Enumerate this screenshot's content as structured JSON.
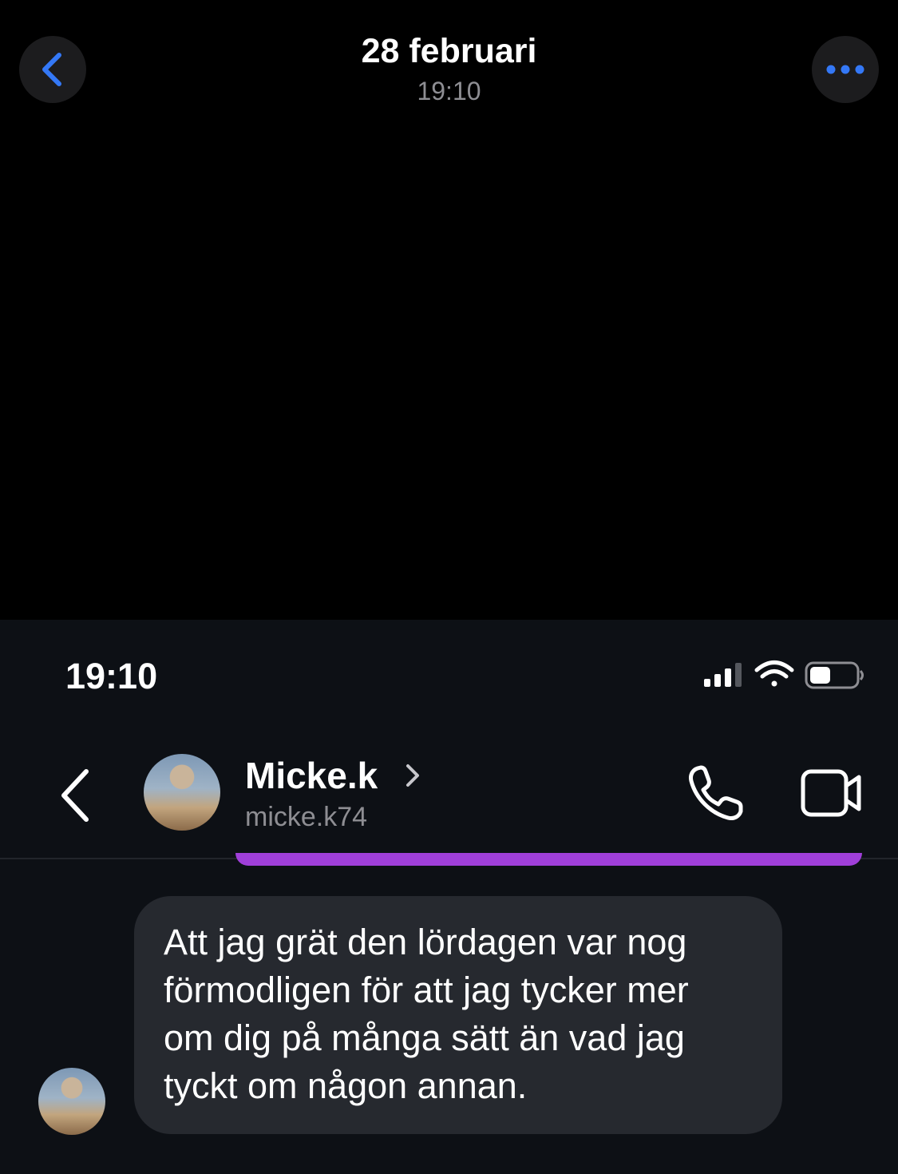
{
  "viewer": {
    "date": "28 februari",
    "time": "19:10",
    "back_icon": "chevron-left-icon",
    "more_icon": "ellipsis-icon",
    "accent_color": "#3478f6"
  },
  "status_bar": {
    "time": "19:10",
    "signal_icon": "signal-icon",
    "wifi_icon": "wifi-icon",
    "battery_icon": "battery-icon",
    "battery_level": 0.45
  },
  "chat_header": {
    "name": "Micke.k",
    "handle": "micke.k74",
    "back_icon": "chevron-left-icon",
    "name_chevron_icon": "chevron-right-icon",
    "call_icon": "phone-icon",
    "video_icon": "video-camera-icon"
  },
  "messages": [
    {
      "direction": "incoming",
      "text": "Att jag grät den lördagen var nog\nförmodligen för att jag tycker mer\nom dig på många sätt än vad jag\ntyckt om någon annan."
    }
  ],
  "colors": {
    "previous_bubble": "#a03fd9",
    "incoming_bubble": "#26292f",
    "chat_background": "#0d1015"
  }
}
